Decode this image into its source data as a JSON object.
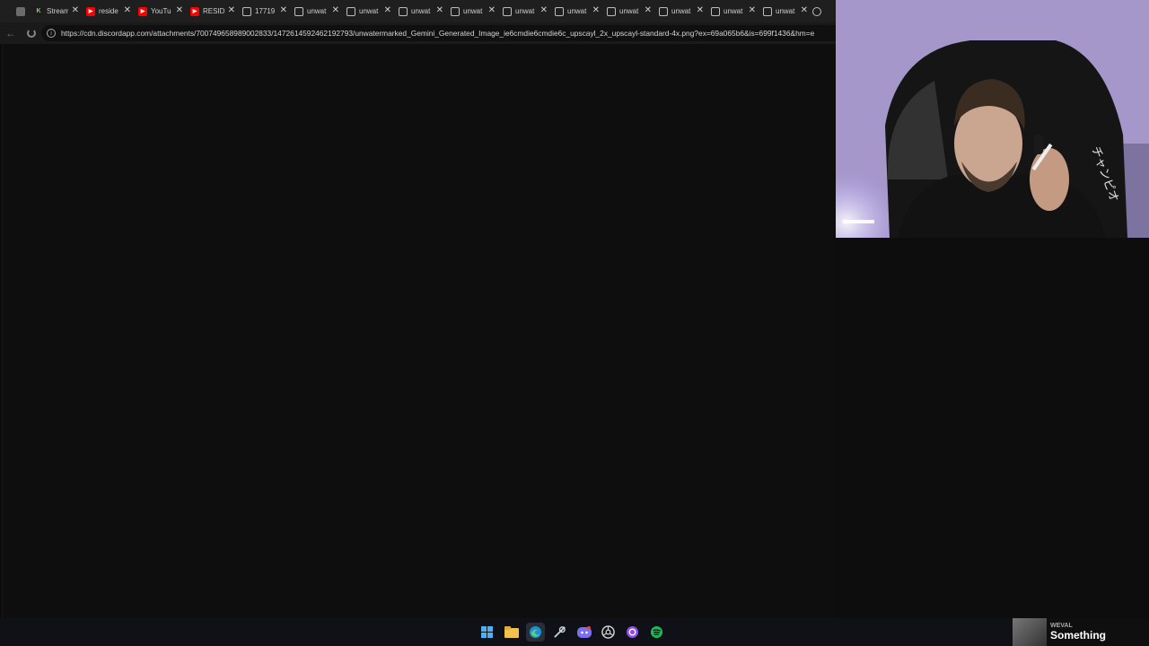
{
  "tabs": [
    {
      "title": "Stream",
      "icon": "kick-icon"
    },
    {
      "title": "reside",
      "icon": "youtube-icon"
    },
    {
      "title": "YouTu",
      "icon": "youtube-icon"
    },
    {
      "title": "RESID",
      "icon": "youtube-icon"
    },
    {
      "title": "17719",
      "icon": "globe-icon"
    },
    {
      "title": "unwat",
      "icon": "globe-icon"
    },
    {
      "title": "unwat",
      "icon": "globe-icon"
    },
    {
      "title": "unwat",
      "icon": "globe-icon"
    },
    {
      "title": "unwat",
      "icon": "globe-icon"
    },
    {
      "title": "unwat",
      "icon": "globe-icon"
    },
    {
      "title": "unwat",
      "icon": "globe-icon"
    },
    {
      "title": "unwat",
      "icon": "globe-icon"
    },
    {
      "title": "unwat",
      "icon": "globe-icon"
    },
    {
      "title": "unwat",
      "icon": "globe-icon"
    },
    {
      "title": "unwat",
      "icon": "globe-icon"
    }
  ],
  "tab_close_glyph": "✕",
  "address_bar": {
    "url": "https://cdn.discordapp.com/attachments/700749658989002833/1472614592462192793/unwatermarked_Gemini_Generated_Image_ie6cmdie6cmdie6c_upscayl_2x_upscayl-standard-4x.png?ex=69a065b6&is=699f1436&hm=e"
  },
  "webcam": {
    "jacket_text": "チャンピオ"
  },
  "taskbar": {
    "icons": [
      "windows-start-icon",
      "file-explorer-icon",
      "edge-browser-icon",
      "steam-icon",
      "discord-icon",
      "chrome-icon",
      "app-icon",
      "spotify-icon"
    ]
  },
  "now_playing": {
    "artist": "WEVAL",
    "song": "Something"
  }
}
